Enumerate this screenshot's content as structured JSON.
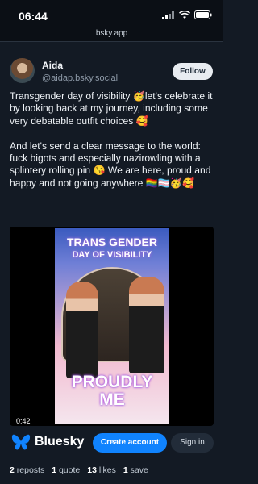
{
  "status_bar": {
    "time": "06:44"
  },
  "browser": {
    "url": "bsky.app"
  },
  "author": {
    "display_name": "Aida",
    "handle": "@aidap.bsky.social"
  },
  "follow_label": "Follow",
  "post": {
    "text_1": "Transgender day of visibility 🥳let's celebrate it by looking back at my journey, including some very debatable outfit choices 🥰",
    "text_2": "And let's send a clear message to the world: fuck bigots and especially nazirowling with a splintery rolling pin 😘 We are here, proud and happy and not going anywhere 🏳️‍🌈🏳️‍⚧️🥳🥰"
  },
  "video": {
    "poster_title_1": "TRANS GENDER",
    "poster_title_2": "DAY OF VISIBILITY",
    "poster_footer_1": "PROUDLY",
    "poster_footer_2": "ME",
    "duration": "0:42"
  },
  "footer": {
    "brand": "Bluesky",
    "create_account": "Create account",
    "sign_in": "Sign in"
  },
  "stats": {
    "reposts_count": "2",
    "reposts_label": "reposts",
    "quotes_count": "1",
    "quotes_label": "quote",
    "likes_count": "13",
    "likes_label": "likes",
    "saves_count": "1",
    "saves_label": "save"
  },
  "colors": {
    "accent": "#1083fe",
    "background": "#131a24"
  },
  "icons": [
    "signal-icon",
    "wifi-icon",
    "battery-icon",
    "butterfly-logo-icon"
  ]
}
